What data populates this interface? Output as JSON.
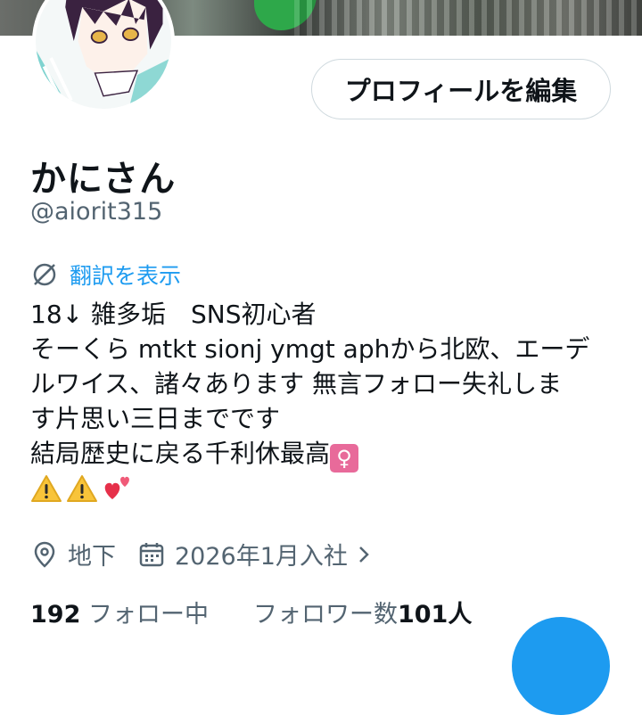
{
  "profile": {
    "edit_button_label": "プロフィールを編集",
    "display_name": "かにさん",
    "handle": "@aiorit315",
    "translate_label": "翻訳を表示",
    "bio": {
      "line1": "18↓ 雑多垢　SNS初心者",
      "line2": "そーくら mtkt sionj ymgt aphから北欧、エーデ",
      "line3": "ルワイス、諸々あります 無言フォロー失礼しま",
      "line4": "す片思い三日までです",
      "line5": "結局歴史に戻る千利休最高",
      "emoji_female": "♀"
    },
    "location": "地下",
    "joined": "2026年1月入社",
    "following_count": "192",
    "following_label": "フォロー中",
    "followers_label": "フォロワー数",
    "followers_count": "101人"
  },
  "icons": {
    "translate": "translate-icon",
    "location": "location-pin-icon",
    "calendar": "calendar-icon",
    "chevron": "chevron-right-icon"
  },
  "colors": {
    "accent": "#1d9bf0",
    "text_primary": "#0f1419",
    "text_secondary": "#536471",
    "border": "#cfd9de"
  }
}
